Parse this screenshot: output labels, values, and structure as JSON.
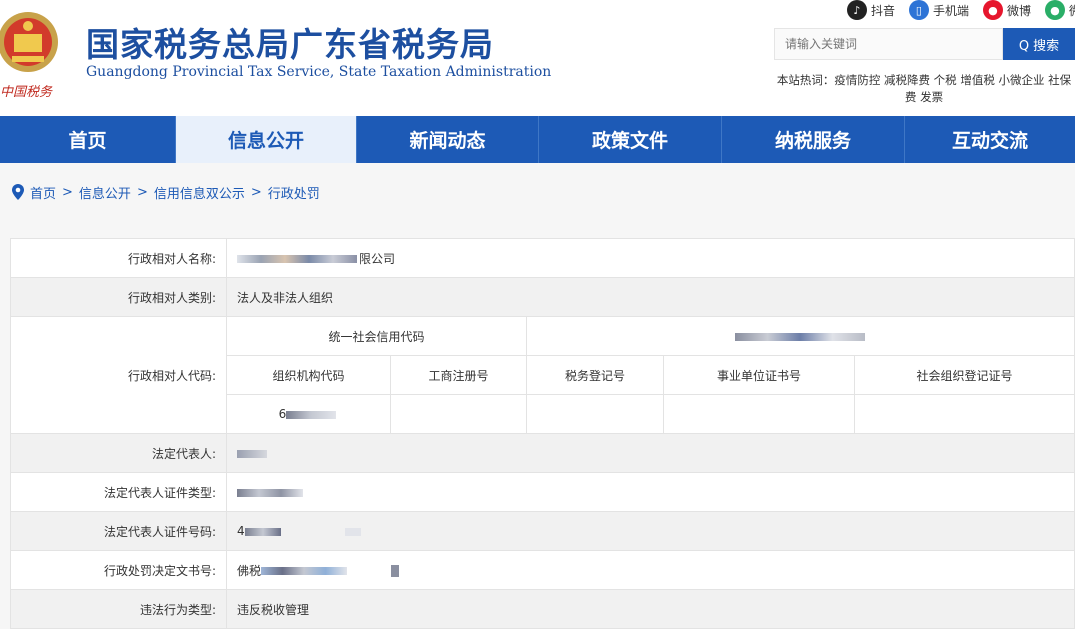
{
  "header": {
    "title_cn": "国家税务总局广东省税务局",
    "title_en": "Guangdong Provincial Tax Service, State Taxation Administration",
    "logo_caption": "中国税务",
    "social": [
      {
        "name": "douyin",
        "label": "抖音",
        "color": "#222222"
      },
      {
        "name": "mobile",
        "label": "手机端",
        "color": "#2e74d6"
      },
      {
        "name": "weibo",
        "label": "微博",
        "color": "#e6162d"
      },
      {
        "name": "wechat",
        "label": "微",
        "color": "#2aae67"
      }
    ],
    "search": {
      "placeholder": "请输入关键词",
      "button": "Q 搜索"
    },
    "hot_words": "本站热词：疫情防控 减税降费 个税 增值税 小微企业 社保费 发票"
  },
  "nav": {
    "tabs": [
      {
        "label": "首页",
        "active": false
      },
      {
        "label": "信息公开",
        "active": true
      },
      {
        "label": "新闻动态",
        "active": false
      },
      {
        "label": "政策文件",
        "active": false
      },
      {
        "label": "纳税服务",
        "active": false
      },
      {
        "label": "互动交流",
        "active": false
      }
    ]
  },
  "breadcrumb": [
    "首页",
    "信息公开",
    "信用信息双公示",
    "行政处罚"
  ],
  "breadcrumb_sep": ">",
  "record": {
    "name_label": "行政相对人名称:",
    "name_value": "限公司",
    "category_label": "行政相对人类别:",
    "category_value": "法人及非法人组织",
    "code_label": "行政相对人代码:",
    "uscc_label": "统一社会信用代码",
    "sub_headers": [
      "组织机构代码",
      "工商注册号",
      "税务登记号",
      "事业单位证书号",
      "社会组织登记证号"
    ],
    "org_code_prefix": "6",
    "legal_rep_label": "法定代表人:",
    "id_type_label": "法定代表人证件类型:",
    "id_number_label": "法定代表人证件号码:",
    "id_number_prefix": "4",
    "decision_label": "行政处罚决定文书号:",
    "decision_prefix": "佛税",
    "violation_label": "违法行为类型:",
    "violation_value": "违反税收管理"
  }
}
